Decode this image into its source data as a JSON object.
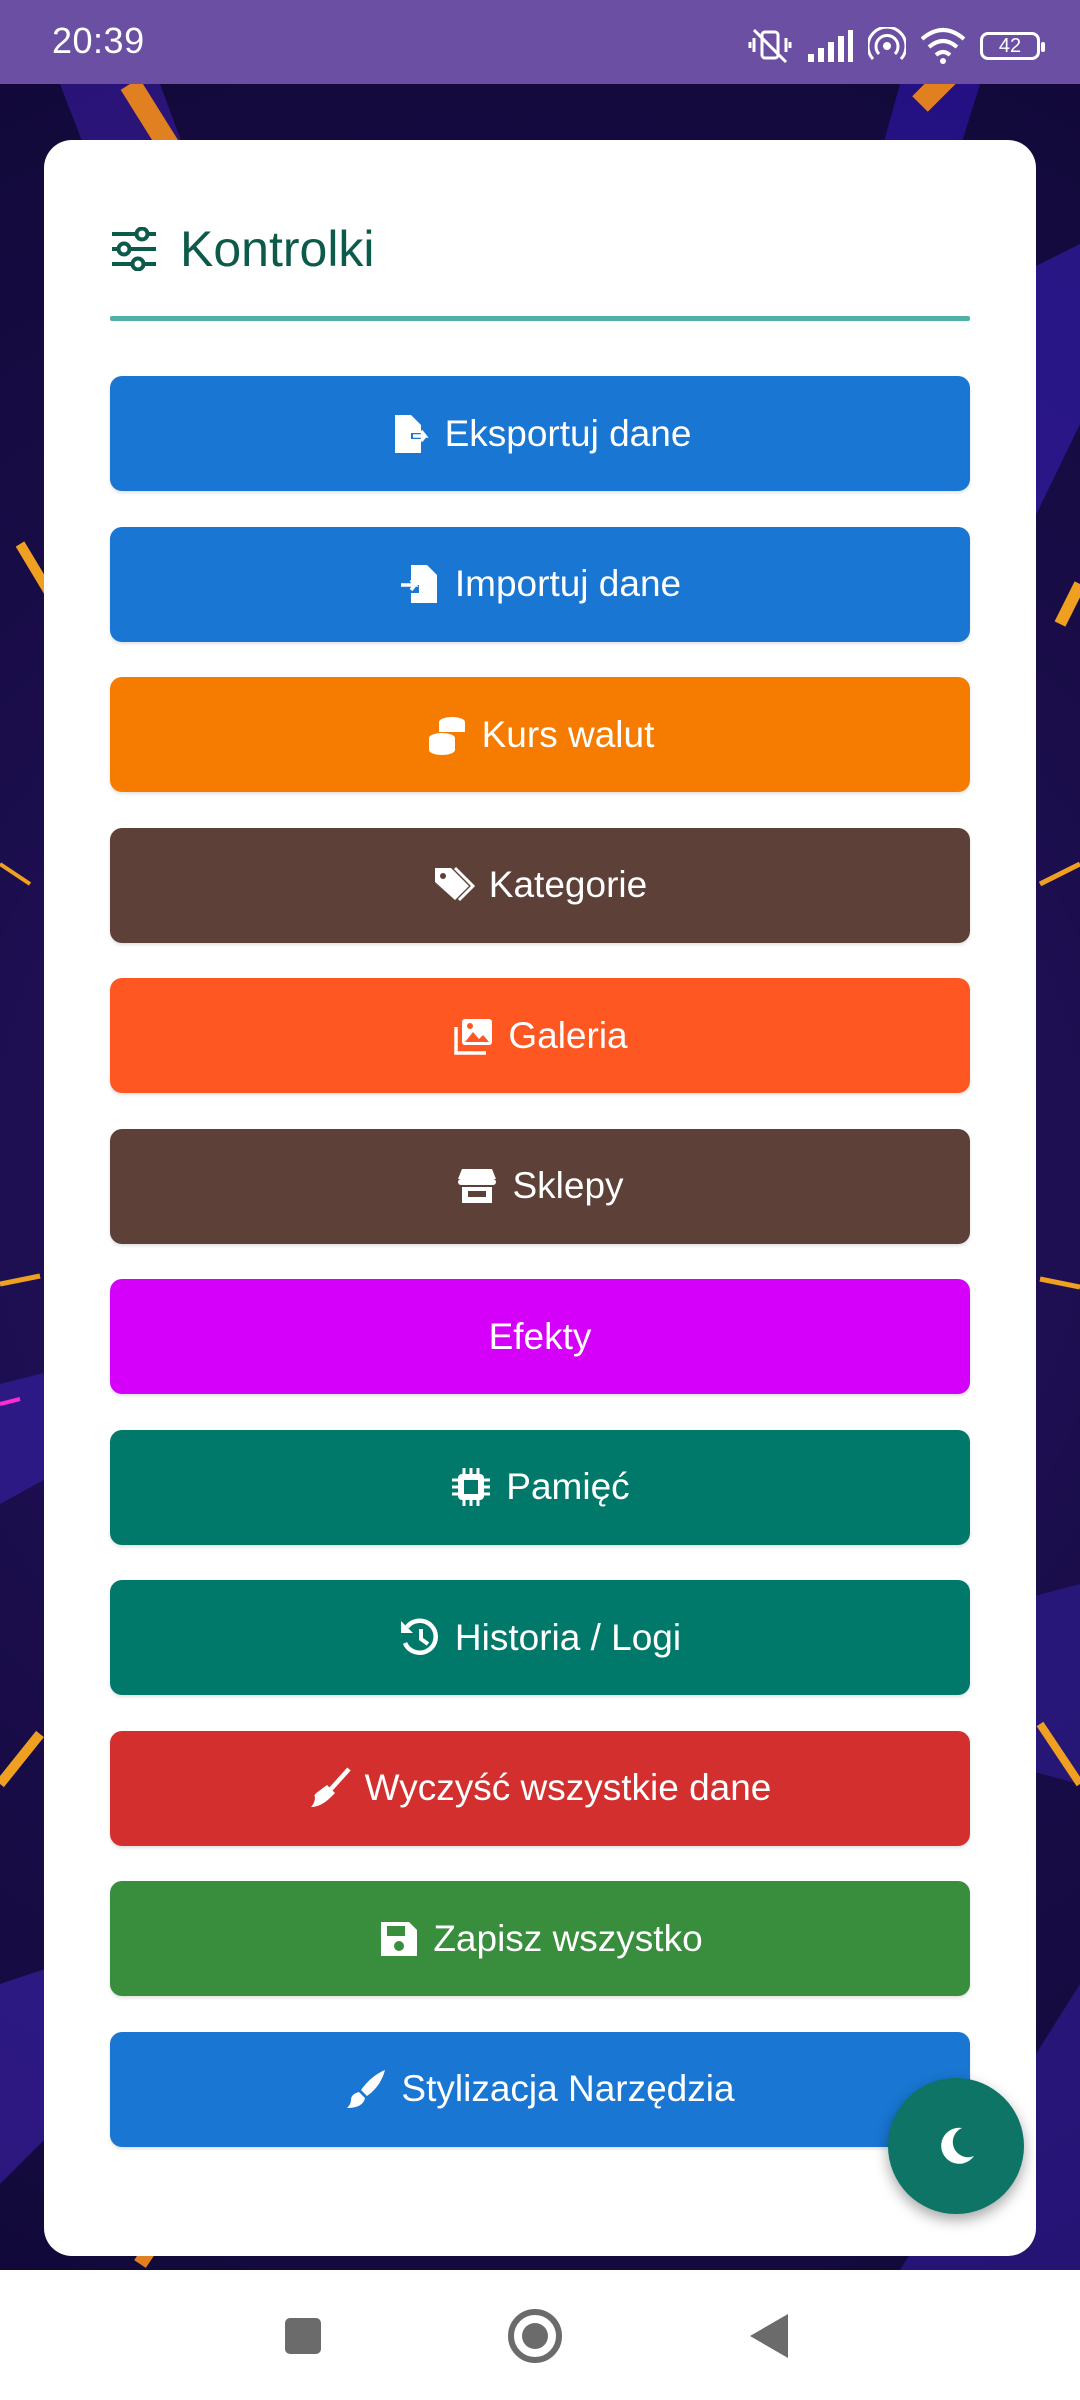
{
  "status_bar": {
    "time": "20:39",
    "battery": "42",
    "icons": [
      "mute-vibrate-icon",
      "signal-icon",
      "hotspot-icon",
      "wifi-icon",
      "battery-icon"
    ]
  },
  "card": {
    "title": "Kontrolki",
    "title_icon": "sliders-icon",
    "accent_color": "#0b5a4a",
    "divider_color": "#4fb0a4"
  },
  "buttons": [
    {
      "label": "Eksportuj dane",
      "icon": "file-export-icon",
      "color": "#1976d2"
    },
    {
      "label": "Importuj dane",
      "icon": "file-import-icon",
      "color": "#1976d2"
    },
    {
      "label": "Kurs walut",
      "icon": "coins-icon",
      "color": "#f57c00"
    },
    {
      "label": "Kategorie",
      "icon": "tags-icon",
      "color": "#5d4037"
    },
    {
      "label": "Galeria",
      "icon": "images-icon",
      "color": "#ff5722"
    },
    {
      "label": "Sklepy",
      "icon": "store-icon",
      "color": "#5d4037"
    },
    {
      "label": "Efekty",
      "icon": "",
      "color": "#d500f9"
    },
    {
      "label": "Pamięć",
      "icon": "microchip-icon",
      "color": "#00796b"
    },
    {
      "label": "Historia / Logi",
      "icon": "history-icon",
      "color": "#00796b"
    },
    {
      "label": "Wyczyść wszystkie dane",
      "icon": "broom-icon",
      "color": "#d32f2f"
    },
    {
      "label": "Zapisz wszystko",
      "icon": "save-icon",
      "color": "#388e3c"
    },
    {
      "label": "Stylizacja Narzędzia",
      "icon": "paintbrush-icon",
      "color": "#1976d2"
    }
  ],
  "fab": {
    "icon": "moon-icon",
    "color": "#0d7466"
  },
  "nav": {
    "icons": [
      "recent-apps-icon",
      "home-icon",
      "back-icon"
    ]
  }
}
